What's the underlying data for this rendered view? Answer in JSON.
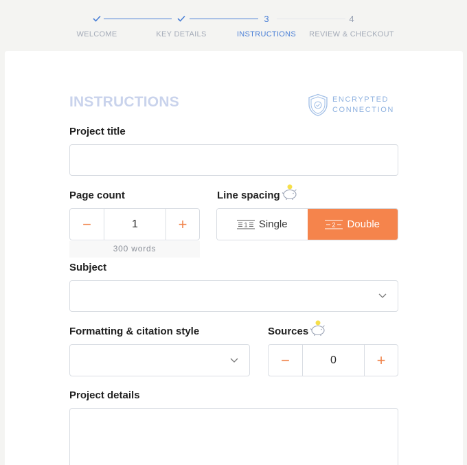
{
  "stepper": {
    "steps": [
      {
        "label": "WELCOME",
        "marker": "✓",
        "state": "done"
      },
      {
        "label": "KEY DETAILS",
        "marker": "✓",
        "state": "done"
      },
      {
        "label": "INSTRUCTIONS",
        "marker": "3",
        "state": "active"
      },
      {
        "label": "REVIEW & CHECKOUT",
        "marker": "4",
        "state": "todo"
      }
    ]
  },
  "section": {
    "title": "INSTRUCTIONS",
    "encrypted_line1": "ENCRYPTED",
    "encrypted_line2": "CONNECTION"
  },
  "form": {
    "project_title": {
      "label": "Project title",
      "value": "",
      "placeholder": ""
    },
    "page_count": {
      "label": "Page count",
      "value": "1",
      "minus": "−",
      "plus": "+",
      "hint": "300 words"
    },
    "line_spacing": {
      "label": "Line spacing",
      "options": [
        {
          "label": "Single",
          "icon": "single-spacing-icon",
          "selected": false
        },
        {
          "label": "Double",
          "icon": "double-spacing-icon",
          "selected": true
        }
      ]
    },
    "subject": {
      "label": "Subject",
      "value": ""
    },
    "formatting": {
      "label": "Formatting & citation style",
      "value": ""
    },
    "sources": {
      "label": "Sources",
      "value": "0",
      "minus": "−",
      "plus": "+"
    },
    "project_details": {
      "label": "Project details",
      "value": ""
    }
  },
  "colors": {
    "accent_blue": "#4a7fd6",
    "accent_orange": "#f5844c",
    "title_faded": "#c9d3ec"
  }
}
